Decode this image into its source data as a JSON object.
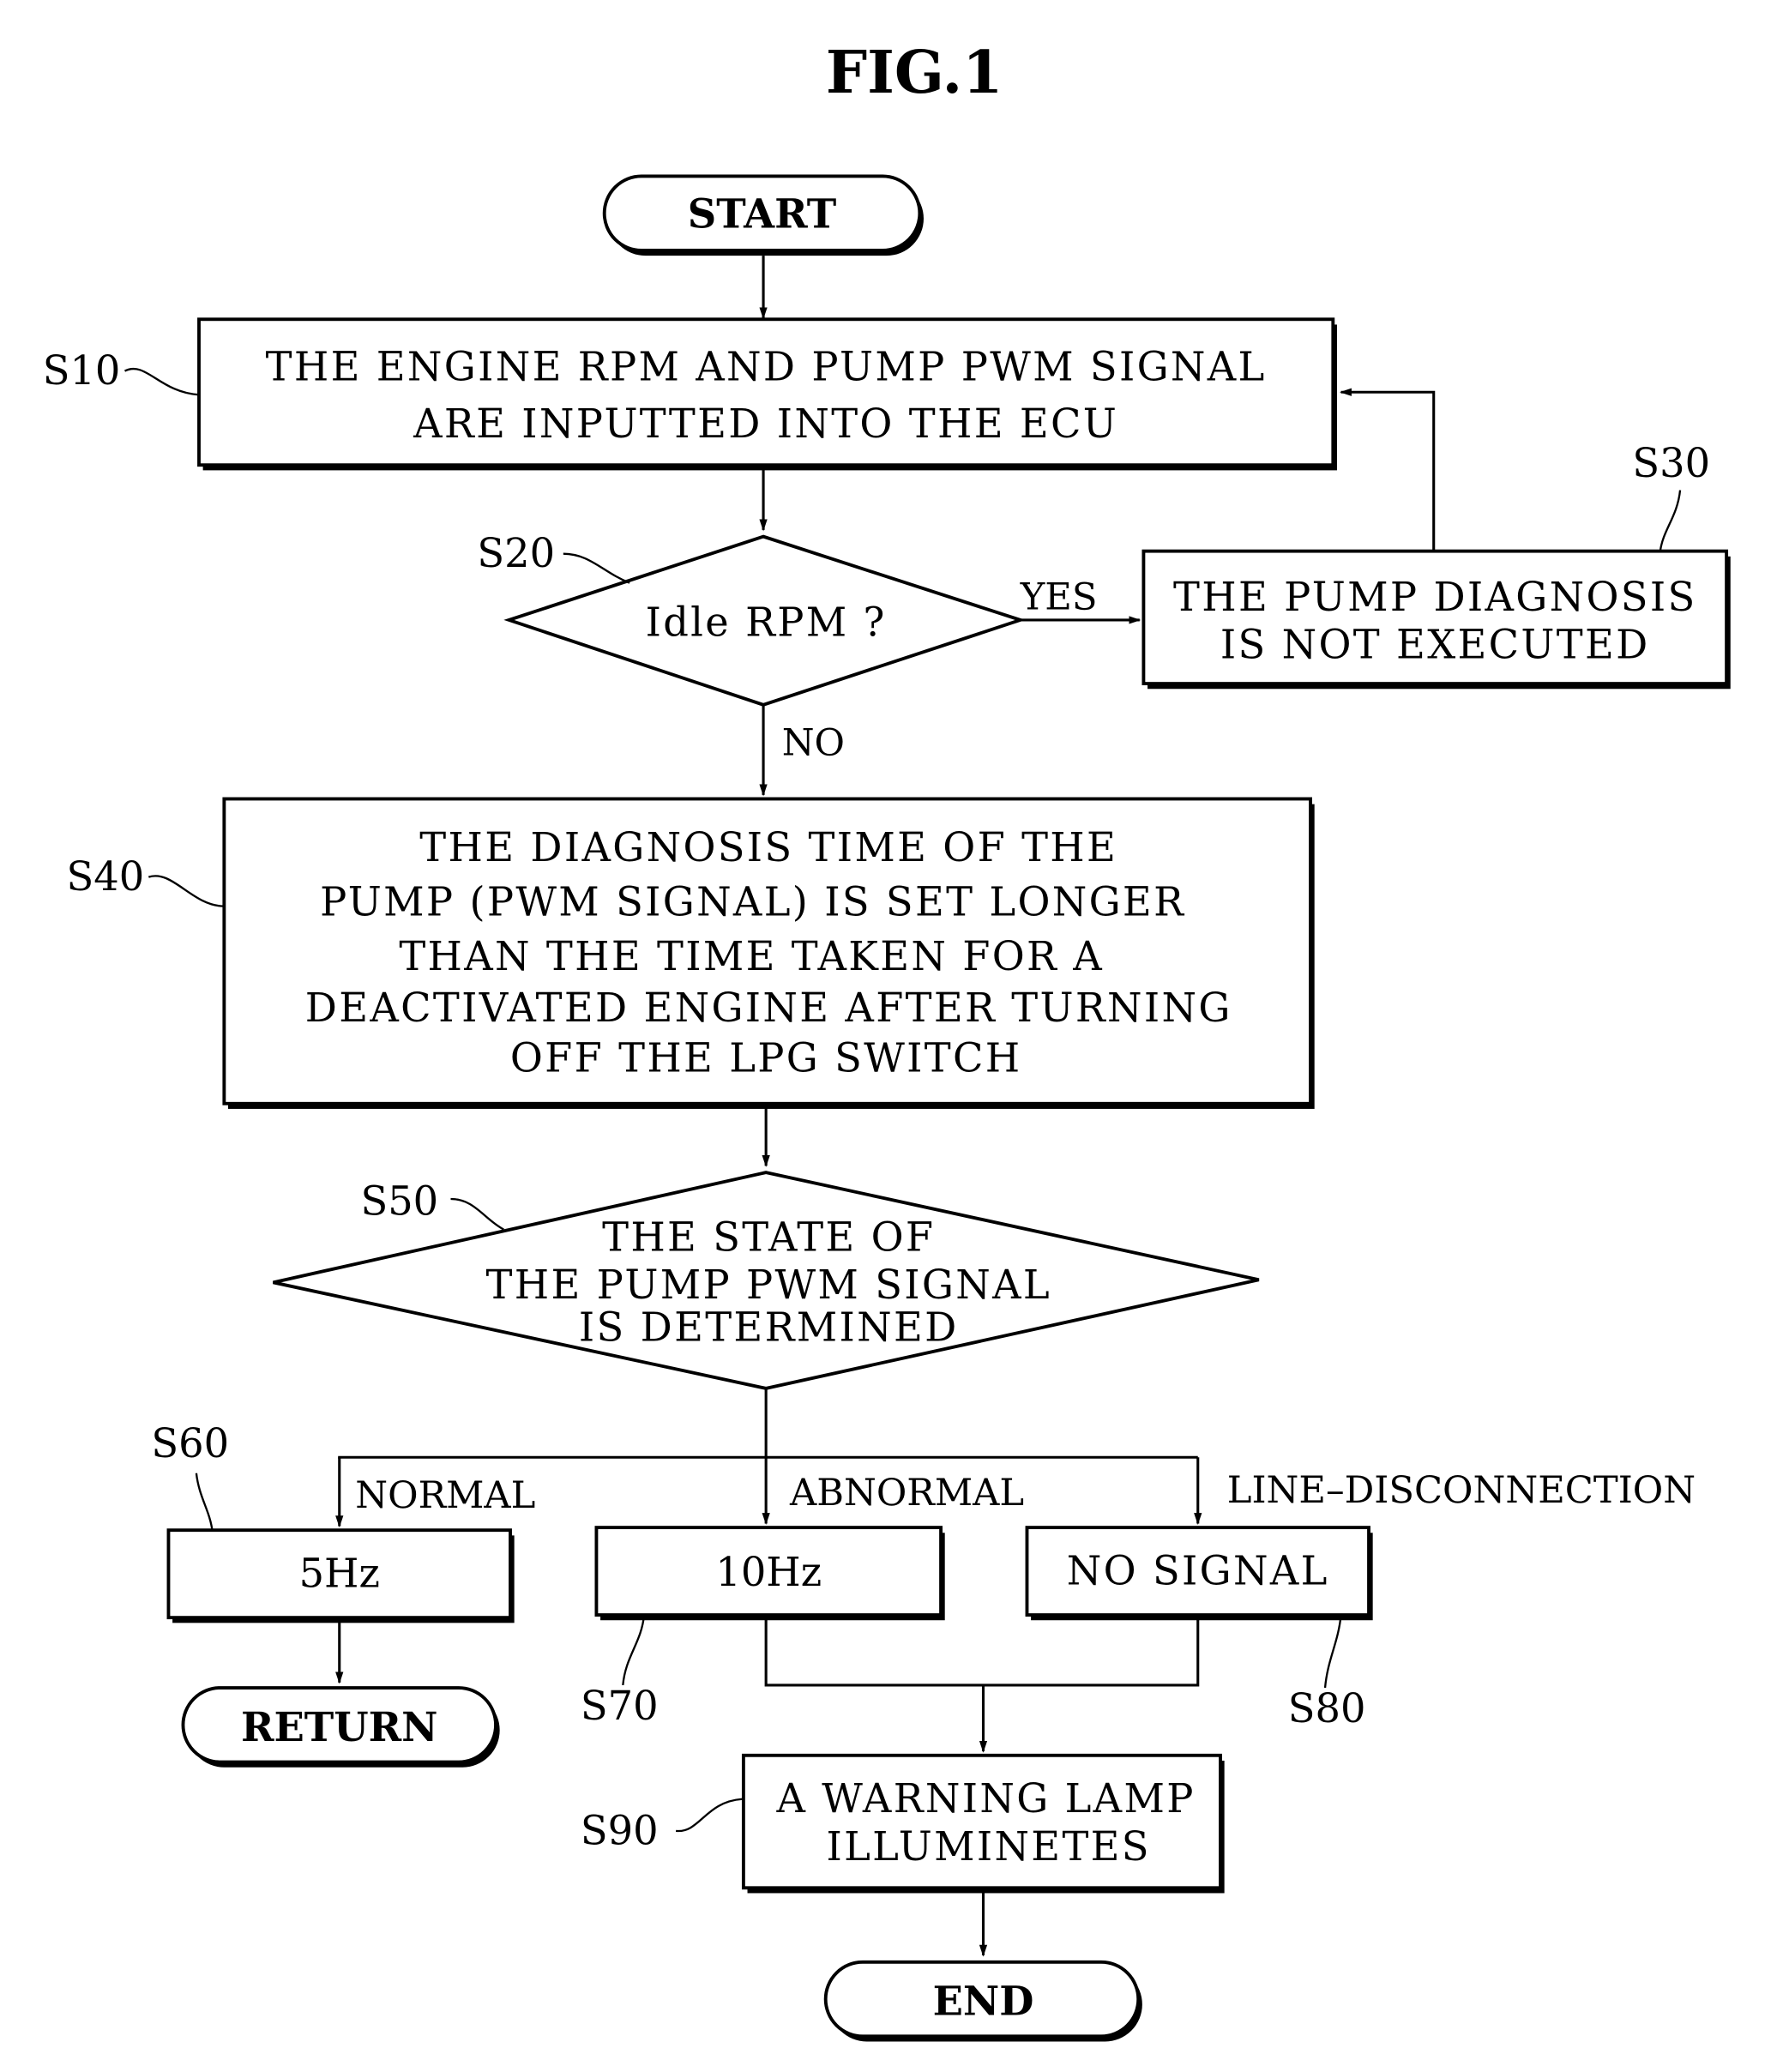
{
  "figure_title": "FIG.1",
  "nodes": {
    "start": {
      "label": "START"
    },
    "s10": {
      "step": "S10",
      "lines": [
        "THE ENGINE RPM AND PUMP PWM SIGNAL",
        "ARE INPUTTED INTO THE ECU"
      ]
    },
    "s20": {
      "step": "S20",
      "lines": [
        "Idle RPM ?"
      ]
    },
    "s30": {
      "step": "S30",
      "lines": [
        "THE PUMP DIAGNOSIS",
        "IS NOT EXECUTED"
      ]
    },
    "s40": {
      "step": "S40",
      "lines": [
        "THE DIAGNOSIS TIME OF THE",
        "PUMP (PWM SIGNAL) IS SET LONGER",
        "THAN THE TIME TAKEN FOR A",
        "DEACTIVATED ENGINE AFTER TURNING",
        "OFF THE LPG SWITCH"
      ]
    },
    "s50": {
      "step": "S50",
      "lines": [
        "THE STATE OF",
        "THE PUMP PWM SIGNAL",
        "IS DETERMINED"
      ]
    },
    "s60": {
      "step": "S60",
      "lines": [
        "5Hz"
      ]
    },
    "s70": {
      "step": "S70",
      "lines": [
        "10Hz"
      ]
    },
    "s80": {
      "step": "S80",
      "lines": [
        "NO SIGNAL"
      ]
    },
    "s90": {
      "step": "S90",
      "lines": [
        "A WARNING LAMP",
        "ILLUMINETES"
      ]
    },
    "return": {
      "label": "RETURN"
    },
    "end": {
      "label": "END"
    }
  },
  "edges": {
    "yes": "YES",
    "no": "NO",
    "normal": "NORMAL",
    "abnormal": "ABNORMAL",
    "line_disconnection": "LINE–DISCONNECTION"
  }
}
